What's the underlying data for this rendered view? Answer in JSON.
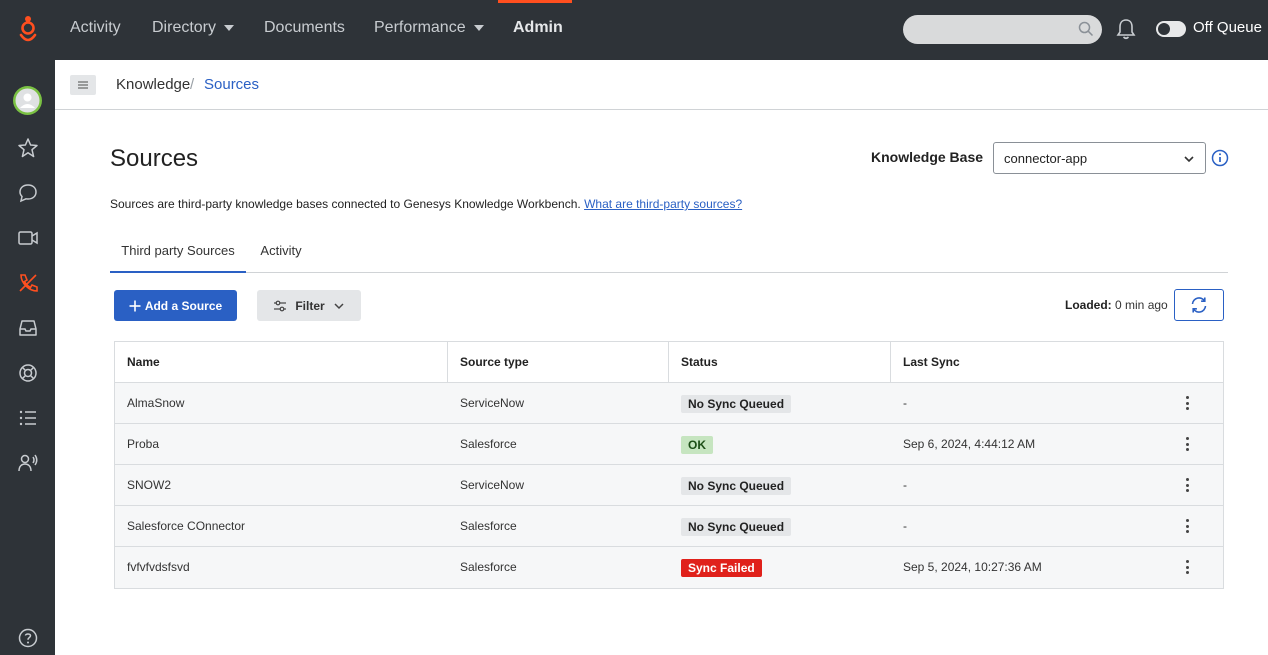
{
  "nav": {
    "items": [
      {
        "label": "Activity",
        "has_caret": false,
        "active": false
      },
      {
        "label": "Directory",
        "has_caret": true,
        "active": false
      },
      {
        "label": "Documents",
        "has_caret": false,
        "active": false
      },
      {
        "label": "Performance",
        "has_caret": true,
        "active": false
      },
      {
        "label": "Admin",
        "has_caret": false,
        "active": true
      }
    ],
    "search_placeholder": "",
    "queue_status": "Off Queue",
    "active_color": "#ff4f1f",
    "brand_color": "#ff4f1f"
  },
  "sidebar": {
    "icons": [
      "avatar-icon",
      "star-icon",
      "chat-icon",
      "video-icon",
      "phone-icon",
      "inbox-icon",
      "lifebuoy-icon",
      "list-icon",
      "user-voice-icon",
      "help-icon"
    ]
  },
  "breadcrumb": {
    "first": "Knowledge",
    "separator": "/",
    "current": "Sources"
  },
  "page": {
    "title": "Sources",
    "kb_label": "Knowledge Base",
    "kb_value": "connector-app",
    "description": "Sources are third-party knowledge bases connected to Genesys Knowledge Workbench.",
    "description_link": "What are third-party sources?"
  },
  "tabs": [
    {
      "label": "Third party Sources",
      "active": true
    },
    {
      "label": "Activity",
      "active": false
    }
  ],
  "toolbar": {
    "add_label": "Add a Source",
    "filter_label": "Filter",
    "loaded_label": "Loaded:",
    "loaded_value": "0 min ago"
  },
  "table": {
    "headers": [
      "Name",
      "Source type",
      "Status",
      "Last Sync"
    ],
    "rows": [
      {
        "name": "AlmaSnow",
        "type": "ServiceNow",
        "status": "No Sync Queued",
        "status_kind": "neutral",
        "last_sync": "-"
      },
      {
        "name": "Proba",
        "type": "Salesforce",
        "status": "OK",
        "status_kind": "ok",
        "last_sync": "Sep 6, 2024, 4:44:12 AM"
      },
      {
        "name": "SNOW2",
        "type": "ServiceNow",
        "status": "No Sync Queued",
        "status_kind": "neutral",
        "last_sync": "-"
      },
      {
        "name": "Salesforce COnnector",
        "type": "Salesforce",
        "status": "No Sync Queued",
        "status_kind": "neutral",
        "last_sync": "-"
      },
      {
        "name": "fvfvfvdsfsvd",
        "type": "Salesforce",
        "status": "Sync Failed",
        "status_kind": "failed",
        "last_sync": "Sep 5, 2024, 10:27:36 AM"
      }
    ]
  },
  "colors": {
    "primary": "#2a60c4",
    "status_ok_bg": "#c6e5c0",
    "status_failed_bg": "#e0211b",
    "status_neutral_bg": "#e4e6e8"
  }
}
